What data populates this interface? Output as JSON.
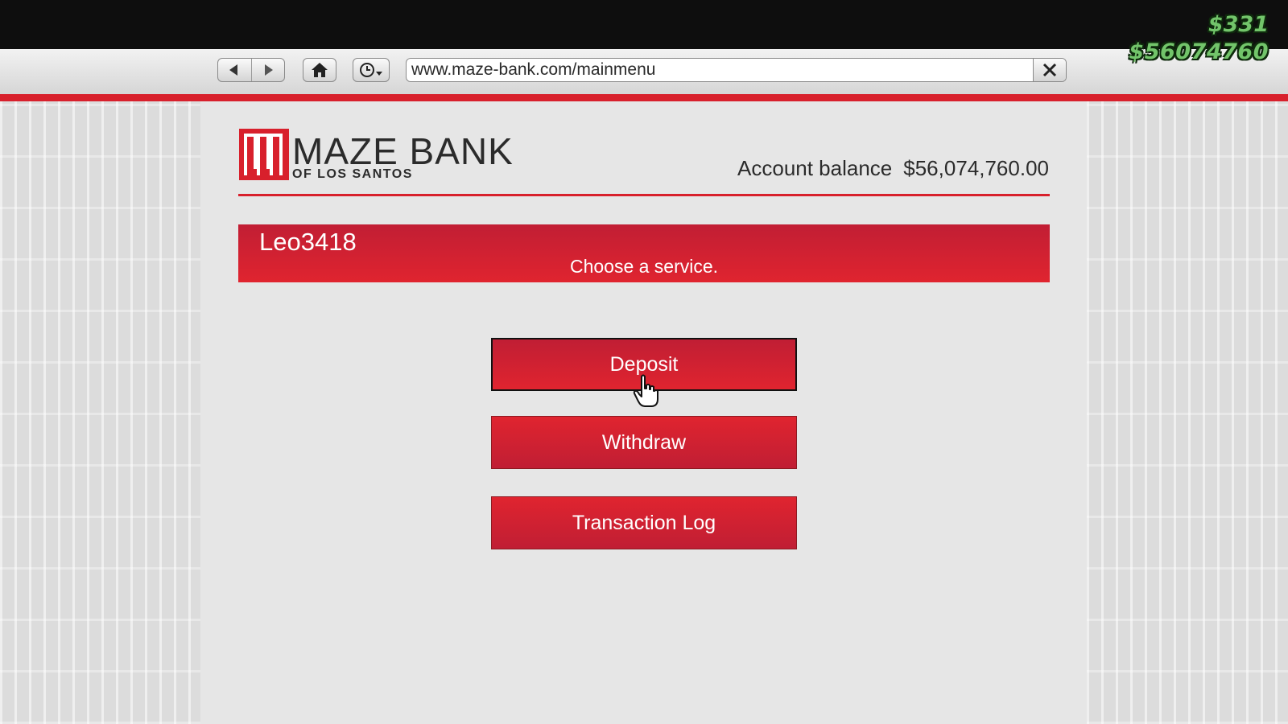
{
  "browser": {
    "url": "www.maze-bank.com/mainmenu"
  },
  "hud": {
    "cash": "$331",
    "bank": "$56074760"
  },
  "header": {
    "logo_title": "MAZE BANK",
    "logo_subtitle": "OF LOS SANTOS",
    "balance_label": "Account balance",
    "balance_value": "$56,074,760.00"
  },
  "banner": {
    "username": "Leo3418",
    "prompt": "Choose a service."
  },
  "services": {
    "deposit": "Deposit",
    "withdraw": "Withdraw",
    "transaction_log": "Transaction Log"
  },
  "colors": {
    "brand_red": "#d8202c",
    "hud_green": "#72c46a"
  },
  "icons": [
    "back-icon",
    "forward-icon",
    "home-icon",
    "history-icon",
    "close-icon",
    "maze-bank-logo",
    "hand-cursor-icon"
  ]
}
